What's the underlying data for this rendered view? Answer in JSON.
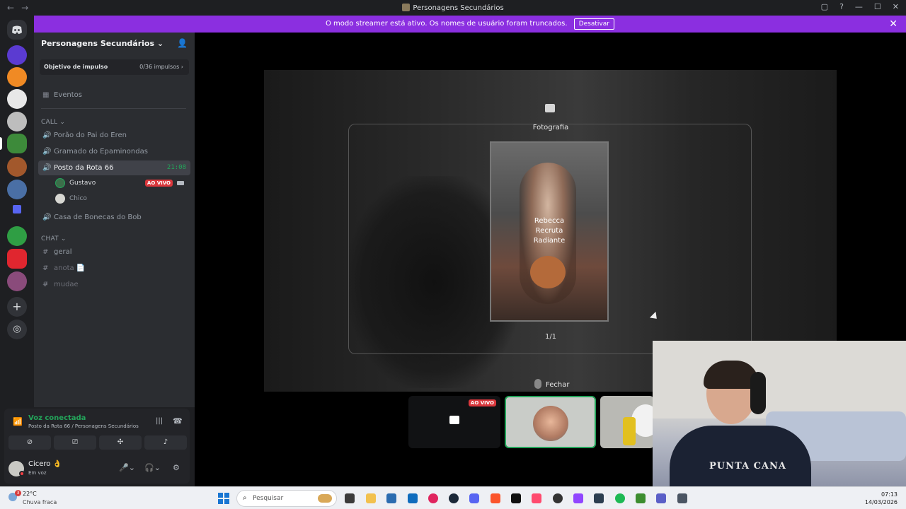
{
  "window": {
    "title": "Personagens Secundários",
    "back": "←",
    "forward": "→",
    "controls": [
      "▢",
      "?",
      "—",
      "☐",
      "✕"
    ]
  },
  "banner": {
    "text": "O modo streamer está ativo. Os nomes de usuário foram truncados.",
    "button": "Desativar",
    "close": "✕"
  },
  "guild": {
    "name": "Personagens Secundários",
    "chevron": "⌄",
    "boost_label": "Objetivo de impulso",
    "boost_progress": "0/36 impulsos",
    "events": "Eventos"
  },
  "categories": {
    "call": "CALL",
    "chat": "CHAT"
  },
  "voice_channels": [
    {
      "name": "Porão do Pai do Eren"
    },
    {
      "name": "Gramado do Epaminondas"
    },
    {
      "name": "Posto da Rota 66",
      "time": "21:08"
    },
    {
      "name": "Casa de Bonecas do Bob"
    }
  ],
  "members": [
    {
      "name": "Gustavo",
      "badge": "AO VIVO"
    },
    {
      "name": "Chico"
    }
  ],
  "text_channels": [
    {
      "name": "geral"
    },
    {
      "name": "anota"
    },
    {
      "name": "mudae"
    }
  ],
  "voice_panel": {
    "status": "Voz conectada",
    "location": "Posto da Rota 66 / Personagens Secundários"
  },
  "user": {
    "name": "Cicero",
    "emoji": "👌",
    "status": "Em voz"
  },
  "game": {
    "item_label": "Fotografia",
    "photo_caption_1": "Rebecca",
    "photo_caption_2": "Recruta",
    "photo_caption_3": "Radiante",
    "counter": "1/1",
    "close": "Fechar"
  },
  "tiles": {
    "live_badge": "AO VIVO",
    "webcam_shirt": "PUNTA CANA"
  },
  "taskbar": {
    "badge": "3",
    "temperature": "22°C",
    "weather": "Chuva fraca",
    "search_placeholder": "Pesquisar",
    "time": "07:13",
    "date": "14/03/2026"
  },
  "colors": {
    "banner": "#8b2fe0",
    "online": "#23a55a",
    "live": "#da373c",
    "sidebar": "#2b2d31",
    "rail": "#1e1f22"
  }
}
